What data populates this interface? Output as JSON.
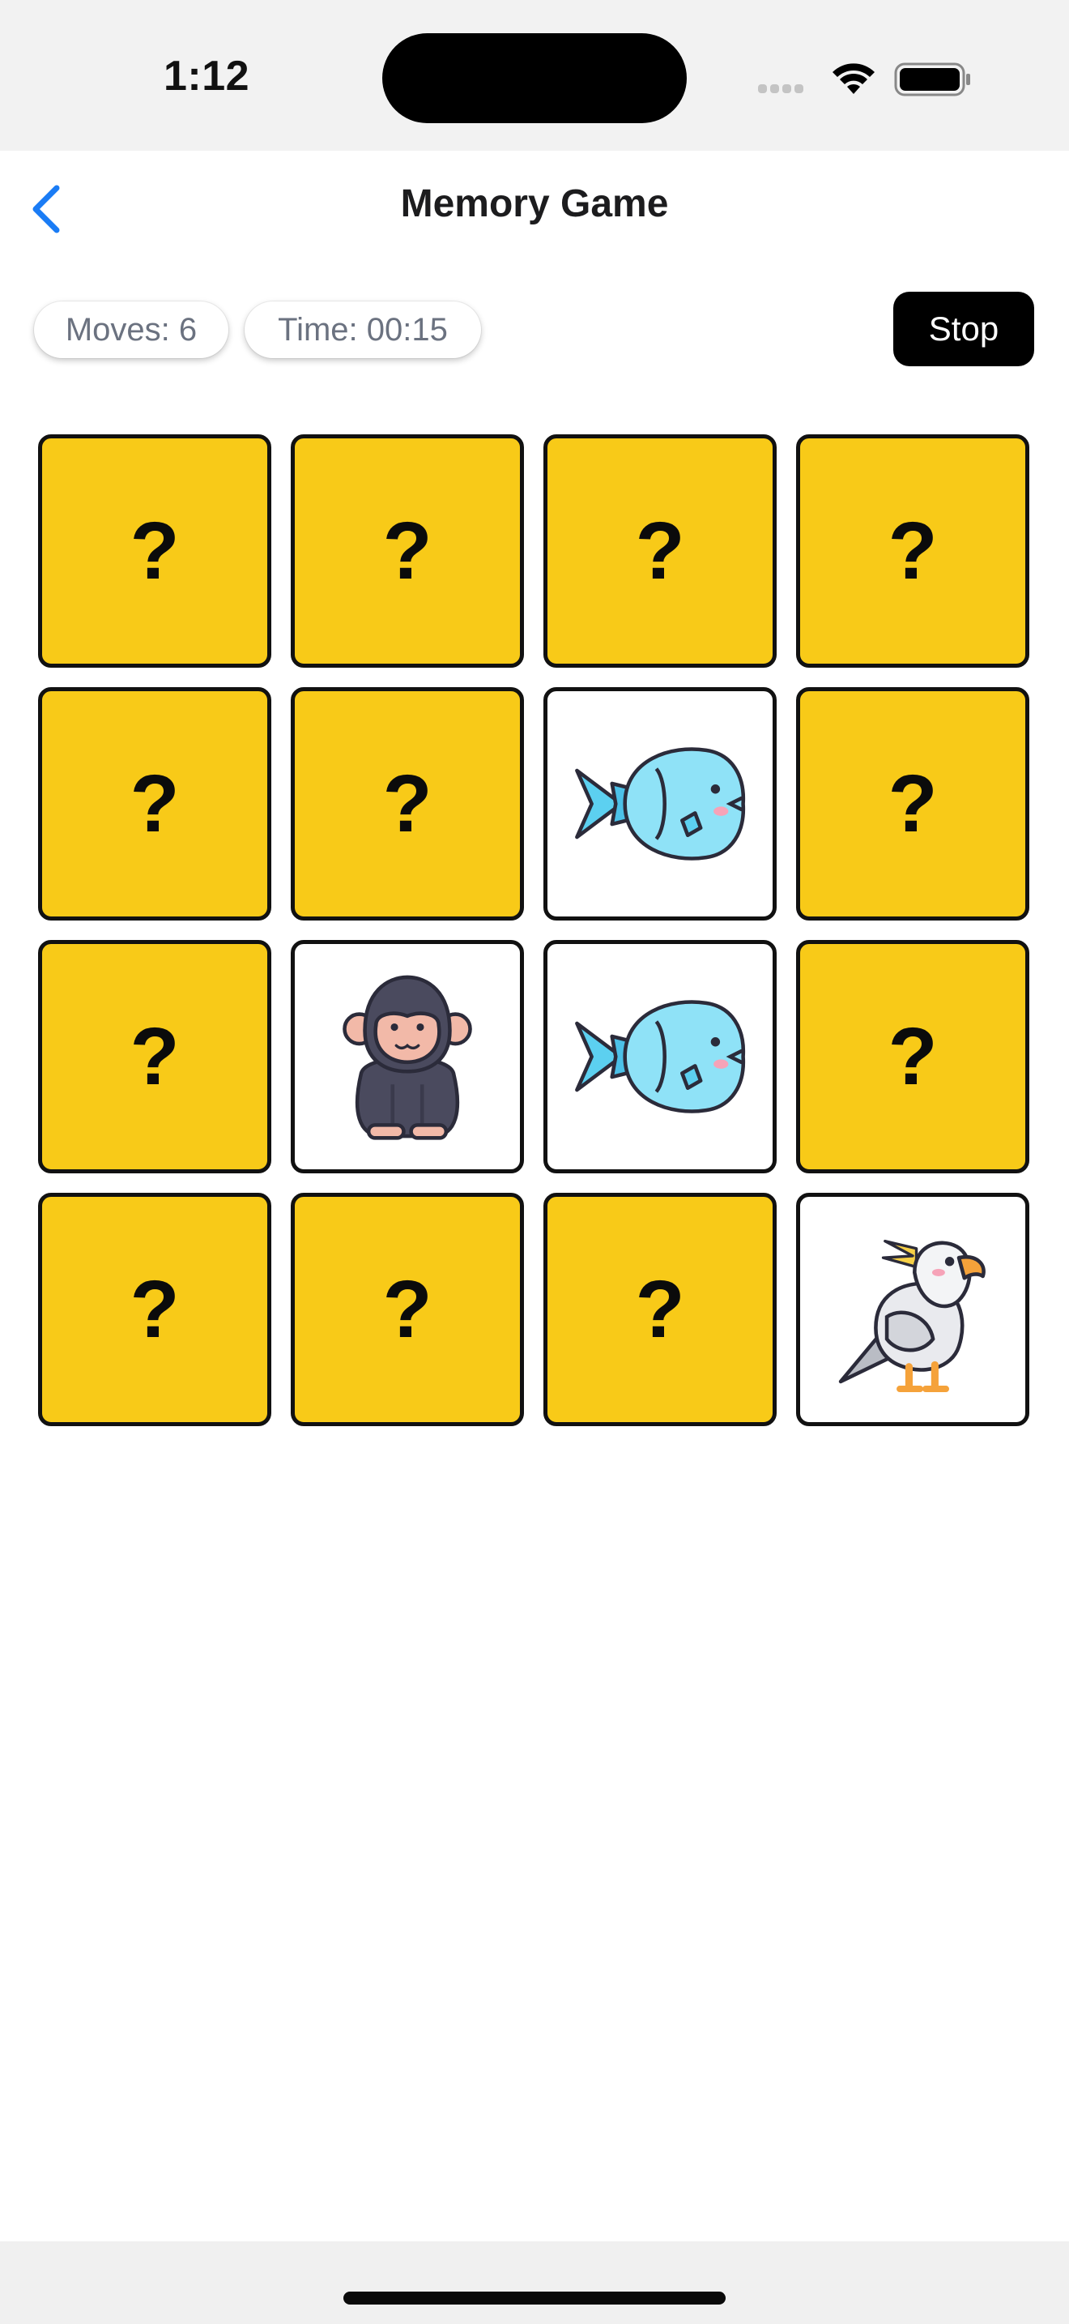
{
  "status_bar": {
    "time": "1:12"
  },
  "nav": {
    "title": "Memory Game",
    "back_icon": "chevron-left-icon"
  },
  "stats": {
    "moves": "Moves: 6",
    "time": "Time: 00:15"
  },
  "controls": {
    "stop_label": "Stop"
  },
  "colors": {
    "card_back": "#f8ca18",
    "accent": "#1a7cf5",
    "stop_button": "#000000"
  },
  "cards": [
    {
      "state": "hidden",
      "label": "?"
    },
    {
      "state": "hidden",
      "label": "?"
    },
    {
      "state": "hidden",
      "label": "?"
    },
    {
      "state": "hidden",
      "label": "?"
    },
    {
      "state": "hidden",
      "label": "?"
    },
    {
      "state": "hidden",
      "label": "?"
    },
    {
      "state": "flipped",
      "icon": "fish-icon"
    },
    {
      "state": "hidden",
      "label": "?"
    },
    {
      "state": "hidden",
      "label": "?"
    },
    {
      "state": "flipped",
      "icon": "gorilla-icon"
    },
    {
      "state": "flipped",
      "icon": "fish-icon"
    },
    {
      "state": "hidden",
      "label": "?"
    },
    {
      "state": "hidden",
      "label": "?"
    },
    {
      "state": "hidden",
      "label": "?"
    },
    {
      "state": "hidden",
      "label": "?"
    },
    {
      "state": "flipped",
      "icon": "cockatoo-icon"
    }
  ]
}
